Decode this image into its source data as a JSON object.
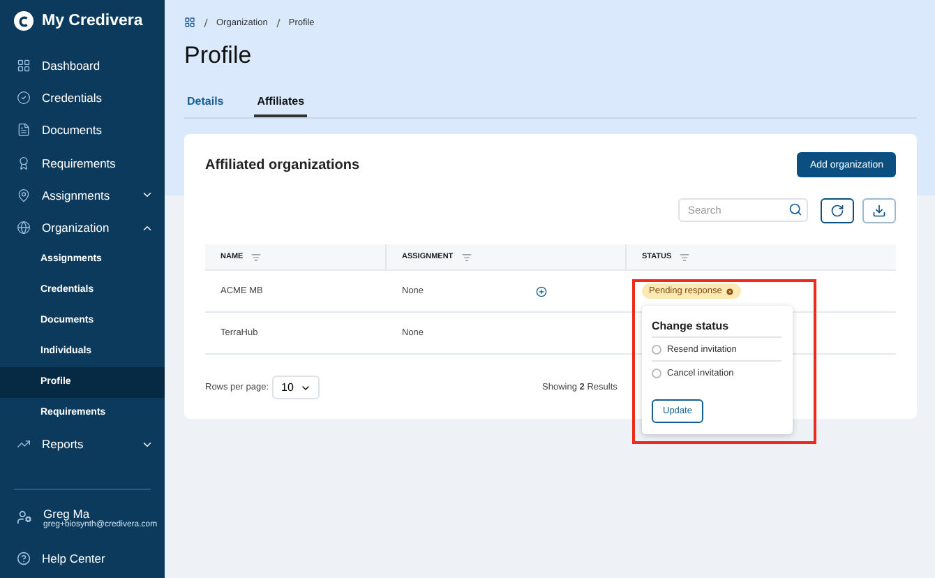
{
  "sidebar": {
    "brand": "My Credivera",
    "items": [
      {
        "label": "Dashboard",
        "selected": false
      },
      {
        "label": "Credentials",
        "selected": false
      },
      {
        "label": "Documents",
        "selected": false
      },
      {
        "label": "Requirements",
        "selected": false
      },
      {
        "label": "Assignments",
        "expanded": false,
        "selected": false
      },
      {
        "label": "Organization",
        "expanded": true,
        "selected": false,
        "children": [
          {
            "label": "Assignments",
            "selected": false
          },
          {
            "label": "Credentials",
            "selected": false
          },
          {
            "label": "Documents",
            "selected": false
          },
          {
            "label": "Individuals",
            "selected": false
          },
          {
            "label": "Profile",
            "selected": true
          },
          {
            "label": "Requirements",
            "selected": false
          }
        ]
      },
      {
        "label": "Reports",
        "expanded": false,
        "selected": false
      }
    ],
    "user": {
      "name": "Greg Ma",
      "email": "greg+biosynth@credivera.com"
    },
    "help": "Help Center"
  },
  "breadcrumb": [
    "Organization",
    "Profile"
  ],
  "title": "Profile",
  "tabs": [
    {
      "label": "Details",
      "selected": false
    },
    {
      "label": "Affiliates",
      "selected": true
    }
  ],
  "card": {
    "title": "Affiliated organizations",
    "add_button": "Add organization",
    "search": {
      "placeholder": "Search"
    },
    "table": {
      "columns": [
        "NAME",
        "ASSIGNMENT",
        "STATUS"
      ],
      "rows": [
        {
          "name": "ACME MB",
          "assignment": "None",
          "status": "Pending response",
          "add_assignment": true
        },
        {
          "name": "TerraHub",
          "assignment": "None",
          "add_assignment": false
        }
      ]
    },
    "rows_per_page": {
      "label": "Rows per page:",
      "value": "10"
    },
    "results": "Showing **2** Results"
  },
  "popover": {
    "title": "Change status",
    "options": [
      {
        "label": "Resend invitation",
        "selected": false
      },
      {
        "label": "Cancel invitation",
        "selected": false
      }
    ],
    "button": "Update"
  }
}
